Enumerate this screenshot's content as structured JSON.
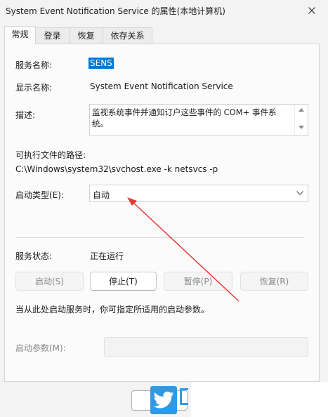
{
  "window": {
    "title": "System Event Notification Service 的属性(本地计算机)",
    "close_icon": "close-icon"
  },
  "tabs": [
    {
      "label": "常规",
      "active": true
    },
    {
      "label": "登录",
      "active": false
    },
    {
      "label": "恢复",
      "active": false
    },
    {
      "label": "依存关系",
      "active": false
    }
  ],
  "general": {
    "service_name_label": "服务名称:",
    "service_name_value": "SENS",
    "display_name_label": "显示名称:",
    "display_name_value": "System Event Notification Service",
    "description_label": "描述:",
    "description_value": "监视系统事件并通知订户这些事件的 COM+ 事件系统。",
    "exe_path_label": "可执行文件的路径:",
    "exe_path_value": "C:\\Windows\\system32\\svchost.exe -k netsvcs -p",
    "startup_type_label": "启动类型(E):",
    "startup_type_value": "自动",
    "status_label": "服务状态:",
    "status_value": "正在运行",
    "hint_text": "当从此处启动服务时，你可指定所适用的启动参数。",
    "start_params_label": "启动参数(M):",
    "start_params_value": ""
  },
  "buttons": {
    "start": "启动(S)",
    "stop": "停止(T)",
    "pause": "暂停(P)",
    "resume": "恢复(R)"
  },
  "colors": {
    "selection": "#0078d4",
    "annotation_arrow": "#e53935",
    "logo": "#2f9ae3"
  }
}
